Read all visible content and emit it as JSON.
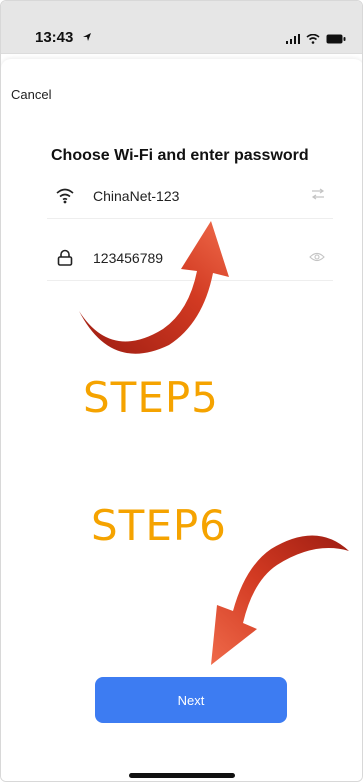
{
  "status_bar": {
    "time": "13:43"
  },
  "nav": {
    "cancel_label": "Cancel"
  },
  "form": {
    "heading": "Choose Wi-Fi and enter password",
    "wifi_name": "ChinaNet-123",
    "password_value": "123456789"
  },
  "annotations": {
    "step5": "STEP5",
    "step6": "STEP6"
  },
  "actions": {
    "next_label": "Next"
  },
  "icons": {
    "wifi": "wifi-icon",
    "lock": "lock-icon",
    "swap": "swap-icon",
    "eye": "eye-icon",
    "location": "location-arrow-icon",
    "signal": "signal-icon",
    "battery": "battery-icon"
  },
  "colors": {
    "primary_button": "#3d7cf2",
    "annotation_text": "#f5a300",
    "annotation_arrow": "#d23a22"
  }
}
